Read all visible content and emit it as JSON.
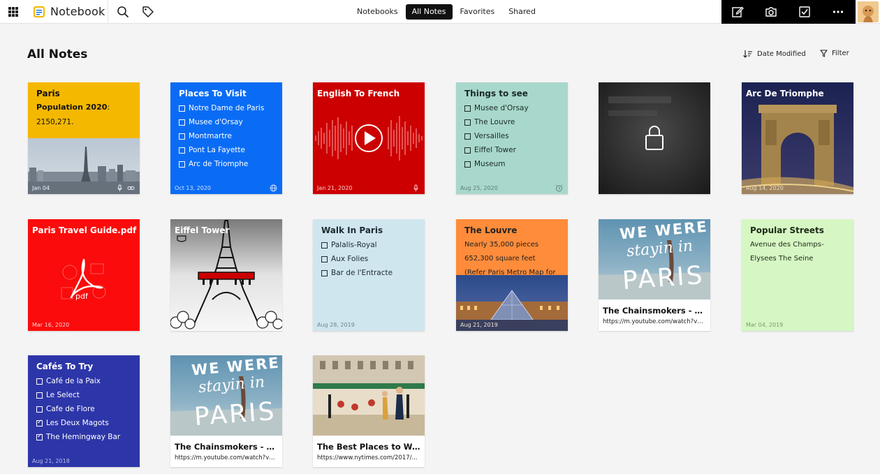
{
  "app": {
    "title": "Notebook"
  },
  "tabs": [
    {
      "label": "Notebooks"
    },
    {
      "label": "All Notes",
      "active": true
    },
    {
      "label": "Favorites"
    },
    {
      "label": "Shared"
    }
  ],
  "toolbar_icons": [
    "compose-icon",
    "camera-icon",
    "checkbox-icon",
    "more-icon"
  ],
  "page": {
    "title": "All Notes",
    "sort_label": "Date Modified",
    "filter_label": "Filter"
  },
  "colors": {
    "yellow": "#f5b800",
    "blue": "#0a6cf5",
    "red": "#cc0000",
    "mint": "#a8d8cb",
    "lightblue": "#d0e6ef",
    "orange": "#ff8c3a",
    "lightgreen": "#d6f7c4",
    "indigo": "#2d36a8",
    "pdfred": "#fb0b0b"
  },
  "cards": {
    "paris": {
      "title": "Paris",
      "line1_bold": "Population 2020",
      "line1_rest": ":",
      "line2": "2150,271.",
      "date": "Jan 04"
    },
    "places": {
      "title": "Places To Visit",
      "items": [
        "Notre Dame de Paris",
        "Musee d'Orsay",
        "Montmartre",
        "Pont La Fayette",
        "Arc de Triomphe"
      ],
      "date": "Oct 13, 2020"
    },
    "english": {
      "title": "English To French",
      "date": "Jan 21, 2020"
    },
    "things": {
      "title": "Things to see",
      "items": [
        "Musee d'Orsay",
        "The Louvre",
        "Versailles",
        "Eiffel Tower",
        "Museum"
      ],
      "date": "Aug 25, 2020"
    },
    "locked": {},
    "arc": {
      "title": "Arc De Triomphe",
      "date": "Aug 14, 2020"
    },
    "pdf": {
      "title": "Paris Travel Guide.pdf",
      "badge": "pdf",
      "date": "Mar 16, 2020"
    },
    "eiffel": {
      "title": "Eiffel Tower"
    },
    "walk": {
      "title": "Walk In Paris",
      "items": [
        "Palalis-Royal",
        "Aux Folies",
        "Bar de l'Entracte"
      ],
      "date": "Aug 28, 2019"
    },
    "louvre": {
      "title": "The Louvre",
      "line1": "Nearly 35,000 pieces",
      "line2": "652,300 square feet",
      "line3": "(Refer Paris Metro Map for",
      "date": "Aug 21, 2019"
    },
    "yt1": {
      "image_text_1": "WE WERE",
      "image_text_2": "stayin in",
      "image_text_3": "PARIS",
      "title": "The Chainsmokers - Pa...",
      "url": "https://m.youtube.com/watch?v=..."
    },
    "streets": {
      "title": "Popular Streets",
      "line1": "Avenue des Champs-",
      "line2": "Elysees The Seine",
      "date": "Mar 04, 2019"
    },
    "cafes": {
      "title": "Cafés To Try",
      "items": [
        {
          "label": "Café de la Paix",
          "checked": false
        },
        {
          "label": "Le Select",
          "checked": false
        },
        {
          "label": "Cafe de Flore",
          "checked": false
        },
        {
          "label": "Les Deux Magots",
          "checked": true
        },
        {
          "label": "The Hemingway Bar",
          "checked": true
        }
      ],
      "date": "Aug 21, 2018"
    },
    "yt2": {
      "image_text_1": "WE WERE",
      "image_text_2": "stayin in",
      "image_text_3": "PARIS",
      "title": "The Chainsmokers - Pa...",
      "url": "https://m.youtube.com/watch?v=..."
    },
    "best": {
      "title": "The Best Places to Wal...",
      "url": "https://www.nytimes.com/2017/..."
    }
  }
}
